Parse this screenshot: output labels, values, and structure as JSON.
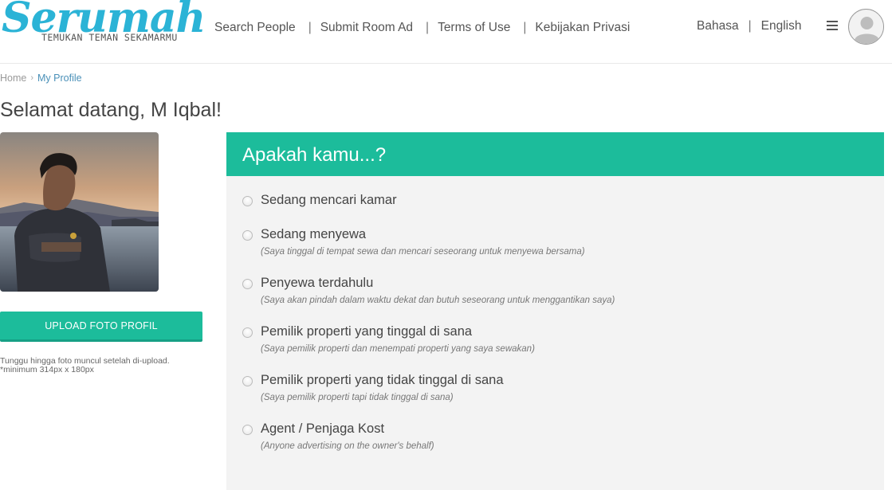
{
  "header": {
    "logo_text": "Serumah",
    "logo_tagline": "TEMUKAN TEMAN SEKAMARMU",
    "nav": [
      {
        "label": "Search People"
      },
      {
        "label": "Submit Room Ad"
      },
      {
        "label": "Terms of Use"
      },
      {
        "label": "Kebijakan Privasi"
      }
    ],
    "language_label": "Bahasa",
    "language_value": "English",
    "menu_icon": "hamburger-icon",
    "avatar_icon": "user-avatar-icon"
  },
  "breadcrumb": {
    "home": "Home",
    "current": "My Profile"
  },
  "page_title": "Selamat datang, M Iqbal!",
  "profile": {
    "upload_button": "UPLOAD FOTO PROFIL",
    "note_line1": "Tunggu hingga foto muncul setelah di-upload.",
    "note_line2": "*minimum 314px x 180px"
  },
  "panel": {
    "title": "Apakah kamu...?",
    "options": [
      {
        "label": "Sedang mencari kamar",
        "desc": ""
      },
      {
        "label": "Sedang menyewa",
        "desc": "(Saya tinggal di tempat sewa dan mencari seseorang untuk menyewa bersama)"
      },
      {
        "label": "Penyewa terdahulu",
        "desc": "(Saya akan pindah dalam waktu dekat dan butuh seseorang untuk menggantikan saya)"
      },
      {
        "label": "Pemilik properti yang tinggal di sana",
        "desc": "(Saya pemilik properti dan menempati properti yang saya sewakan)"
      },
      {
        "label": "Pemilik properti yang tidak tinggal di sana",
        "desc": "(Saya pemilik properti tapi tidak tinggal di sana)"
      },
      {
        "label": "Agent / Penjaga Kost",
        "desc": "(Anyone advertising on the owner's behalf)"
      }
    ]
  },
  "colors": {
    "accent": "#1cbc9b",
    "logo": "#2bb3d6",
    "link": "#4a90b8",
    "panel_bg": "#f3f3f3"
  }
}
